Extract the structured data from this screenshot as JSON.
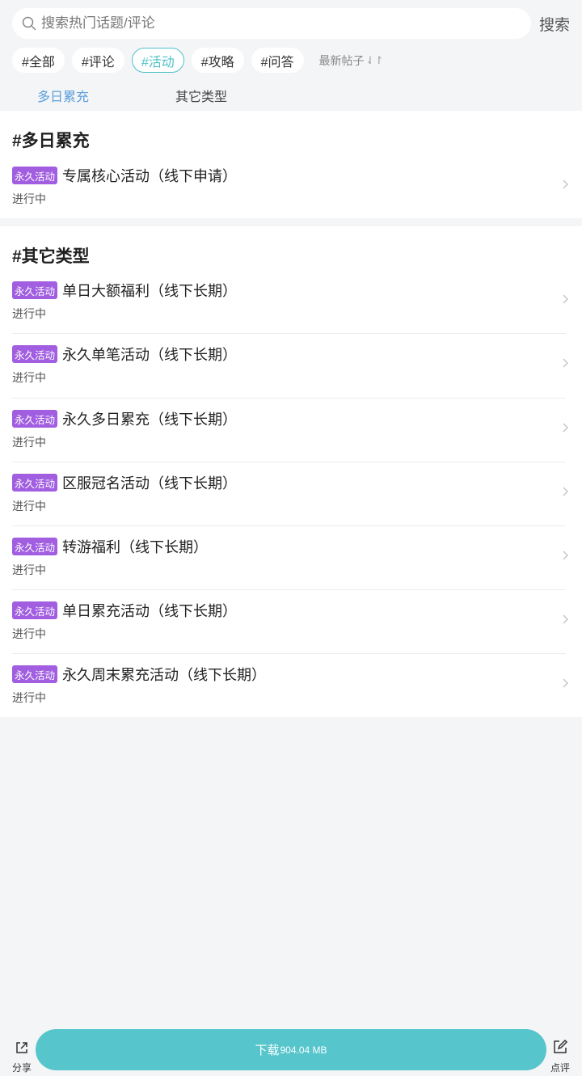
{
  "search": {
    "placeholder": "搜索热门话题/评论",
    "button_label": "搜索"
  },
  "tags": [
    {
      "label": "#全部",
      "active": false
    },
    {
      "label": "#评论",
      "active": false
    },
    {
      "label": "#活动",
      "active": true
    },
    {
      "label": "#攻略",
      "active": false
    },
    {
      "label": "#问答",
      "active": false
    }
  ],
  "sort": {
    "label": "最新帖子",
    "icon": "sort-arrows-icon"
  },
  "subtabs": [
    {
      "label": "多日累充",
      "active": true
    },
    {
      "label": "其它类型",
      "active": false
    }
  ],
  "sections": [
    {
      "title": "#多日累充",
      "items": [
        {
          "badge": "永久活动",
          "title": "专属核心活动（线下申请）",
          "status": "进行中"
        }
      ]
    },
    {
      "title": "#其它类型",
      "items": [
        {
          "badge": "永久活动",
          "title": "单日大额福利（线下长期）",
          "status": "进行中"
        },
        {
          "badge": "永久活动",
          "title": "永久单笔活动（线下长期）",
          "status": "进行中"
        },
        {
          "badge": "永久活动",
          "title": "永久多日累充（线下长期）",
          "status": "进行中"
        },
        {
          "badge": "永久活动",
          "title": "区服冠名活动（线下长期）",
          "status": "进行中"
        },
        {
          "badge": "永久活动",
          "title": "转游福利（线下长期）",
          "status": "进行中"
        },
        {
          "badge": "永久活动",
          "title": "单日累充活动（线下长期）",
          "status": "进行中"
        },
        {
          "badge": "永久活动",
          "title": "永久周末累充活动（线下长期）",
          "status": "进行中"
        }
      ]
    }
  ],
  "bottom": {
    "share_label": "分享",
    "download_label": "下载",
    "download_size": "904.04 MB",
    "review_label": "点评"
  },
  "colors": {
    "accent": "#56c5cc",
    "active_tag": "#4fc1c8",
    "active_subtab": "#5a9fdc",
    "badge": "#a15ee0",
    "background": "#f4f5f7"
  }
}
